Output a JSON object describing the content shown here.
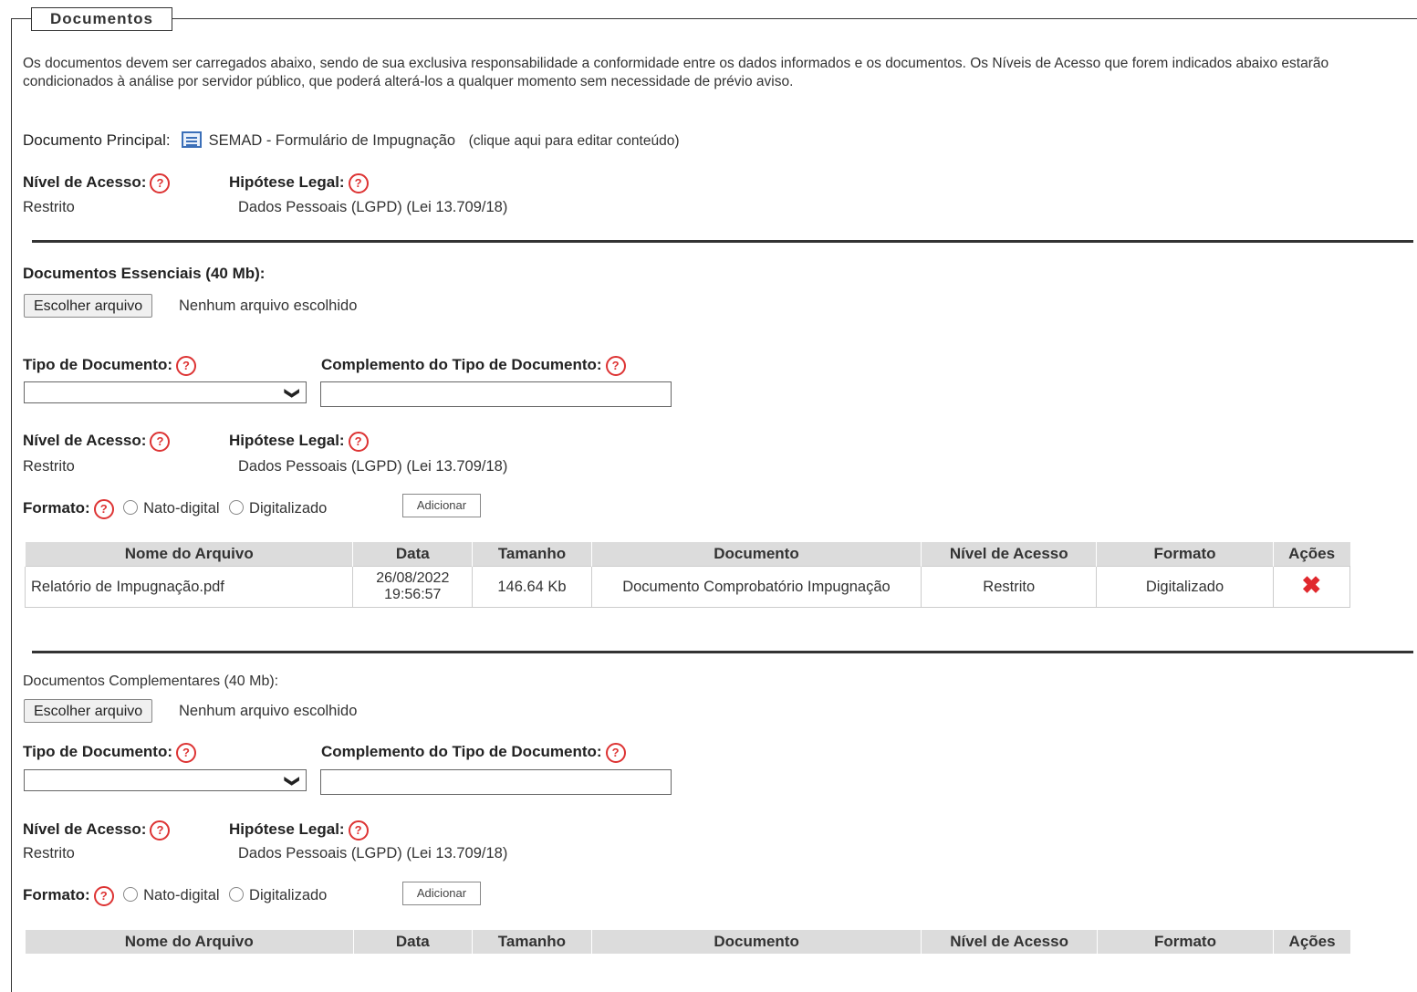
{
  "fieldset": {
    "legend": "Documentos",
    "intro": "Os documentos devem ser carregados abaixo, sendo de sua exclusiva responsabilidade a conformidade entre os dados informados e os documentos. Os Níveis de Acesso que forem indicados abaixo estarão condicionados à análise por servidor público, que poderá alterá-los a qualquer momento sem necessidade de prévio aviso."
  },
  "principal": {
    "label": "Documento Principal:",
    "doc_name": "SEMAD - Formulário de Impugnação",
    "edit_hint": "(clique aqui para editar conteúdo)",
    "nivel_label": "Nível de Acesso:",
    "nivel_value": "Restrito",
    "hipotese_label": "Hipótese Legal:",
    "hipotese_value": "Dados Pessoais (LGPD) (Lei 13.709/18)"
  },
  "essenciais": {
    "label": "Documentos Essenciais (40 Mb):",
    "choose_button": "Escolher arquivo",
    "no_file": "Nenhum arquivo escolhido",
    "tipo_label": "Tipo de Documento:",
    "complemento_label": "Complemento do Tipo de Documento:",
    "nivel_label": "Nível de Acesso:",
    "nivel_value": "Restrito",
    "hipotese_label": "Hipótese Legal:",
    "hipotese_value": "Dados Pessoais (LGPD) (Lei 13.709/18)",
    "formato_label": "Formato:",
    "option_nato": "Nato-digital",
    "option_digitalizado": "Digitalizado",
    "add_button": "Adicionar",
    "table": {
      "headers": [
        "Nome do Arquivo",
        "Data",
        "Tamanho",
        "Documento",
        "Nível de Acesso",
        "Formato",
        "Ações"
      ],
      "rows": [
        {
          "nome": "Relatório de Impugnação.pdf",
          "data_line1": "26/08/2022",
          "data_line2": "19:56:57",
          "tamanho": "146.64 Kb",
          "documento": "Documento Comprobatório Impugnação",
          "nivel": "Restrito",
          "formato": "Digitalizado",
          "acao": "✖"
        }
      ]
    }
  },
  "complementares": {
    "label": "Documentos Complementares (40 Mb):",
    "choose_button": "Escolher arquivo",
    "no_file": "Nenhum arquivo escolhido",
    "tipo_label": "Tipo de Documento:",
    "complemento_label": "Complemento do Tipo de Documento:",
    "nivel_label": "Nível de Acesso:",
    "nivel_value": "Restrito",
    "hipotese_label": "Hipótese Legal:",
    "hipotese_value": "Dados Pessoais (LGPD) (Lei 13.709/18)",
    "formato_label": "Formato:",
    "option_nato": "Nato-digital",
    "option_digitalizado": "Digitalizado",
    "add_button": "Adicionar",
    "table": {
      "headers": [
        "Nome do Arquivo",
        "Data",
        "Tamanho",
        "Documento",
        "Nível de Acesso",
        "Formato",
        "Ações"
      ]
    }
  },
  "icons": {
    "help": "?",
    "chevron": "❯"
  },
  "colors": {
    "help_red": "#d33333",
    "delete_red": "#e0282d",
    "header_gray": "#dcdcdc"
  }
}
